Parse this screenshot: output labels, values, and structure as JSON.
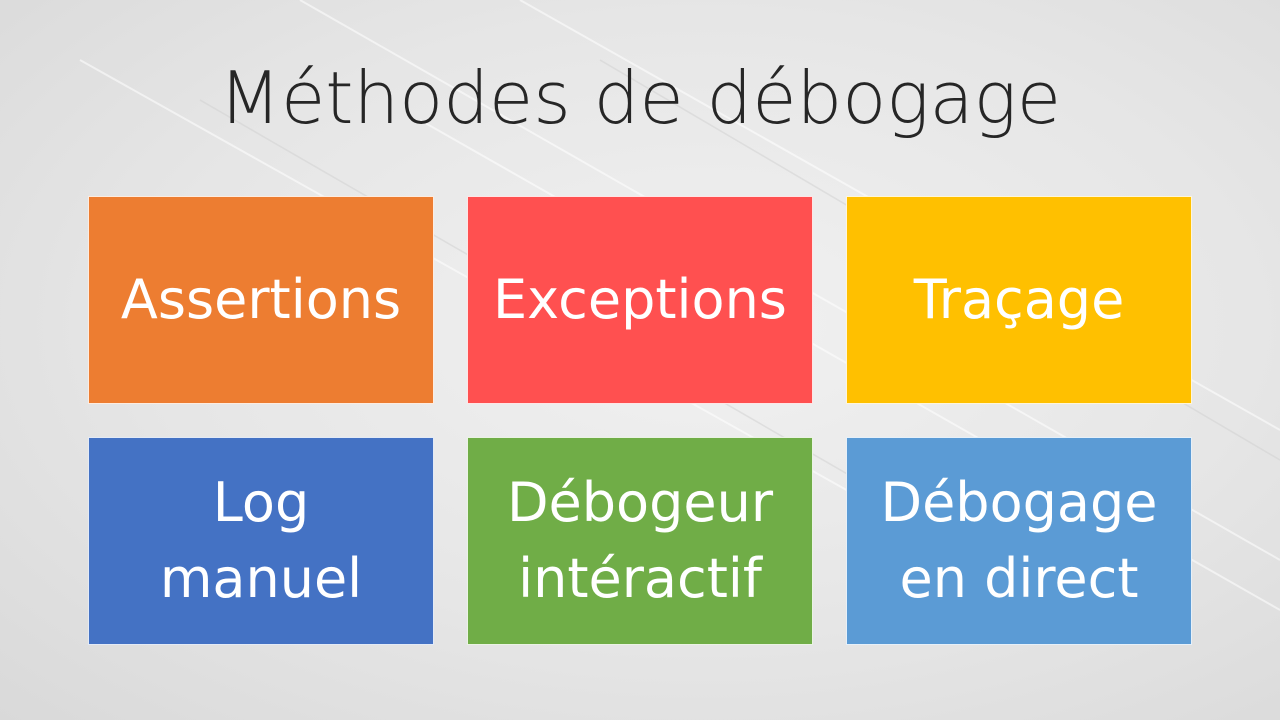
{
  "slide": {
    "title": "Méthodes de débogage"
  },
  "tiles": [
    {
      "lines": [
        "Assertions"
      ],
      "color": "#ed7d31"
    },
    {
      "lines": [
        "Exceptions"
      ],
      "color": "#ff5050"
    },
    {
      "lines": [
        "Traçage"
      ],
      "color": "#ffc000"
    },
    {
      "lines": [
        "Log",
        "manuel"
      ],
      "color": "#4472c4"
    },
    {
      "lines": [
        "Débogeur",
        "intéractif"
      ],
      "color": "#70ad47"
    },
    {
      "lines": [
        "Débogage",
        "en direct"
      ],
      "color": "#5b9bd5"
    }
  ],
  "theme": {
    "background": "#e6e6e6",
    "title_color": "#262626",
    "tile_text_color": "#ffffff"
  }
}
